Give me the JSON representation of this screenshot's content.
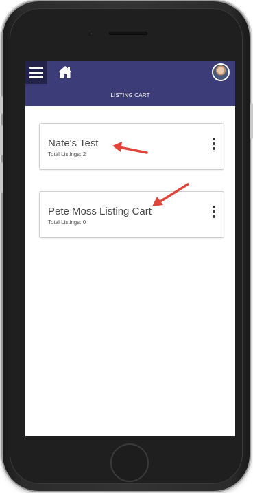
{
  "header": {
    "title": "LISTING CART"
  },
  "icons": {
    "menu": "hamburger-menu-icon",
    "home": "home-icon",
    "avatar": "user-avatar",
    "more": "kebab-menu-icon"
  },
  "carts": [
    {
      "name": "Nate's Test",
      "count_text": "Total Listings: 2"
    },
    {
      "name": "Pete Moss Listing Cart",
      "count_text": "Total Listings: 0"
    }
  ],
  "colors": {
    "header_bg": "#3c3c78",
    "menu_bg": "#22224a",
    "annotation_arrow": "#e0453a"
  }
}
